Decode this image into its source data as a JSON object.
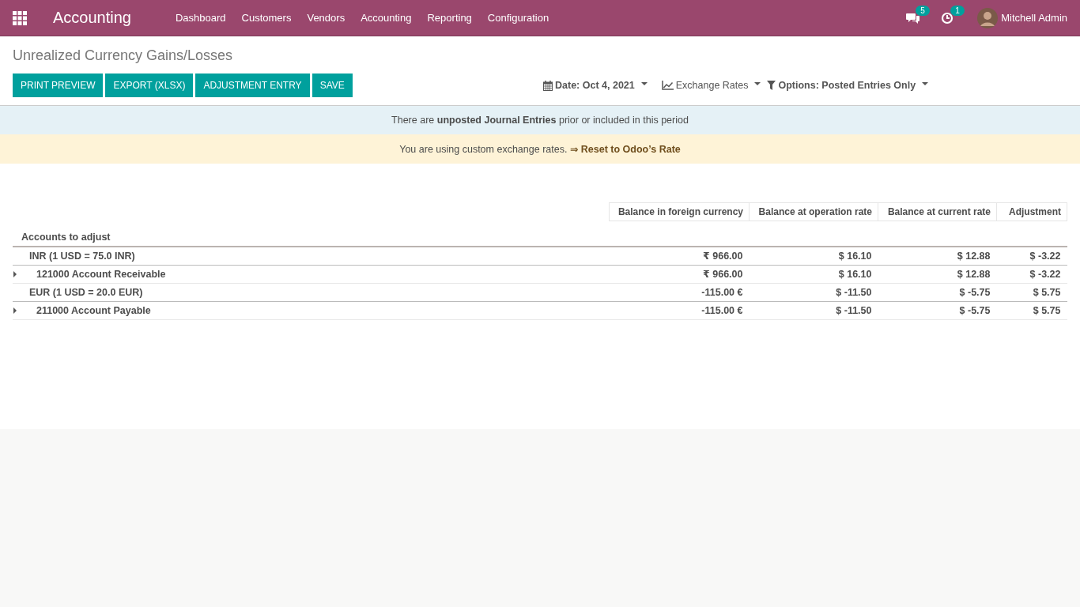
{
  "navbar": {
    "app_title": "Accounting",
    "menu": [
      {
        "label": "Dashboard"
      },
      {
        "label": "Customers"
      },
      {
        "label": "Vendors"
      },
      {
        "label": "Accounting"
      },
      {
        "label": "Reporting"
      },
      {
        "label": "Configuration"
      }
    ],
    "messages_count": "5",
    "activities_count": "1",
    "user": "Mitchell Admin"
  },
  "breadcrumb": "Unrealized Currency Gains/Losses",
  "buttons": [
    "PRINT PREVIEW",
    "EXPORT (XLSX)",
    "ADJUSTMENT ENTRY",
    "SAVE"
  ],
  "filters": [
    {
      "kind": "date",
      "label": "Date: Oct 4, 2021"
    },
    {
      "kind": "rates",
      "label": "Exchange Rates"
    },
    {
      "kind": "options",
      "label": "Options: Posted Entries Only"
    }
  ],
  "alerts": [
    {
      "kind": "info",
      "text": "There are **unposted Journal Entries** prior or included in this period"
    },
    {
      "kind": "warning",
      "text": "You are using custom exchange rates.",
      "link": "⇒ Reset to Odoo’s Rate"
    }
  ],
  "table": {
    "columns": [
      "Balance in foreign currency",
      "Balance at operation rate",
      "Balance at current rate",
      "Adjustment"
    ],
    "section": "Accounts to adjust",
    "rows": [
      {
        "kind": "currency",
        "name": "INR (1 USD = 75.0 INR)",
        "cells": [
          "₹ 966.00",
          "$ 16.10",
          "$ 12.88",
          "$ -3.22"
        ]
      },
      {
        "kind": "account",
        "expanded": false,
        "name": "121000 Account Receivable",
        "cells": [
          "₹ 966.00",
          "$ 16.10",
          "$ 12.88",
          "$ -3.22"
        ]
      },
      {
        "kind": "currency",
        "name": "EUR (1 USD = 20.0 EUR)",
        "cells": [
          "-115.00 €",
          "$ -11.50",
          "$ -5.75",
          "$ 5.75"
        ]
      },
      {
        "kind": "account",
        "expanded": false,
        "name": "211000 Account Payable",
        "cells": [
          "-115.00 €",
          "$ -11.50",
          "$ -5.75",
          "$ 5.75"
        ]
      }
    ]
  }
}
